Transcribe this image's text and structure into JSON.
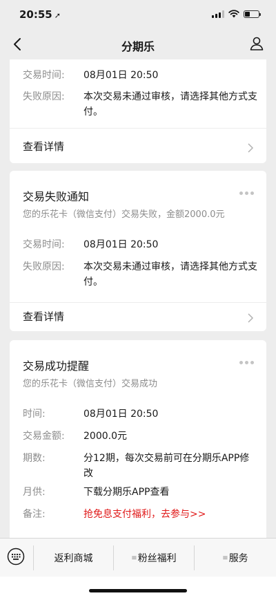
{
  "status": {
    "time": "20:55",
    "arrow": "➚"
  },
  "nav": {
    "title": "分期乐"
  },
  "cards": [
    {
      "title": "",
      "subtitle": "",
      "rows": [
        {
          "label": "交易时间:",
          "value": "08月01日 20:50"
        },
        {
          "label": "失败原因:",
          "value": "本次交易未通过审核，请选择其他方式支付。"
        }
      ],
      "link": "查看详情"
    },
    {
      "title": "交易失败通知",
      "subtitle": "您的乐花卡（微信支付）交易失败，金额2000.0元",
      "rows": [
        {
          "label": "交易时间:",
          "value": "08月01日 20:50"
        },
        {
          "label": "失败原因:",
          "value": "本次交易未通过审核，请选择其他方式支付。"
        }
      ],
      "link": "查看详情"
    },
    {
      "title": "交易成功提醒",
      "subtitle": "您的乐花卡（微信支付）交易成功",
      "rows": [
        {
          "label": "时间:",
          "value": "08月01日 20:50"
        },
        {
          "label": "交易金额:",
          "value": "2000.0元"
        },
        {
          "label": "期数:",
          "value": "分12期，每次交易前可在分期乐APP修改"
        },
        {
          "label": "月供:",
          "value": "下载分期乐APP查看"
        },
        {
          "label": "备注:",
          "value": "抢免息支付福利，去参与>>"
        }
      ]
    }
  ],
  "menu": {
    "items": [
      "返利商城",
      "粉丝福利",
      "服务"
    ],
    "sub_mark": "≡"
  },
  "colors": {
    "background": "#ededed",
    "card": "#ffffff",
    "link_red": "#e01818",
    "muted": "#8c8c8c"
  }
}
